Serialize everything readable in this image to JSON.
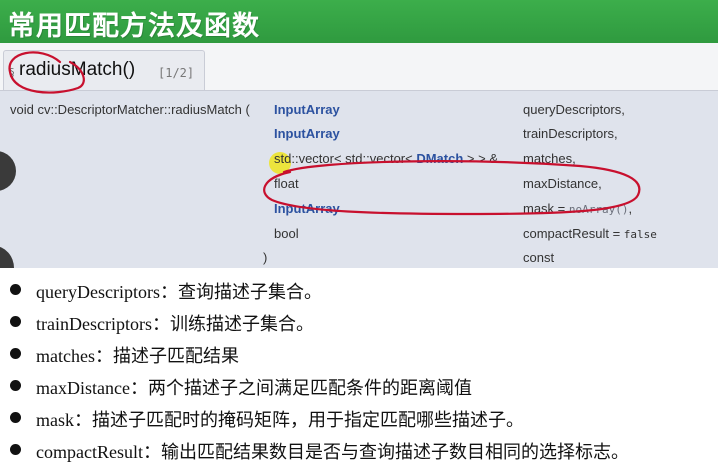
{
  "title": "常用匹配方法及函数",
  "tab": {
    "section_mark": "§",
    "function_name": "radiusMatch()",
    "page_indicator": "[1/2]"
  },
  "signature": {
    "prefix": "void cv::DescriptorMatcher::radiusMatch (",
    "close_paren": ")",
    "params": [
      {
        "type_a": "InputArray",
        "name": "queryDescriptors,"
      },
      {
        "type_a": "InputArray",
        "name": "trainDescriptors,"
      },
      {
        "type_a": "std::vector< std::vector< ",
        "type_b": "DMatch",
        "type_c": " > > &",
        "name": "matches,"
      },
      {
        "type_a": "float",
        "name": "maxDistance,"
      },
      {
        "type_a": "InputArray",
        "name": "mask = ",
        "default": "noArray()",
        "tail": ","
      },
      {
        "type_a": "bool",
        "name": "compactResult = ",
        "default": "false"
      },
      {
        "type_a": "",
        "name": "const"
      }
    ]
  },
  "bullets": [
    "queryDescriptors：查询描述子集合。",
    "trainDescriptors：训练描述子集合。",
    "matches：描述子匹配结果",
    "maxDistance：两个描述子之间满足匹配条件的距离阈值",
    "mask：描述子匹配时的掩码矩阵，用于指定匹配哪些描述子。",
    "compactResult：输出匹配结果数目是否与查询描述子数目相同的选择标志。"
  ],
  "colors": {
    "title_bar": "#2f9a3f",
    "keyword_blue": "#2c52a0",
    "annotation_red": "#c8102e",
    "signature_bg": "#dfe3ec"
  }
}
